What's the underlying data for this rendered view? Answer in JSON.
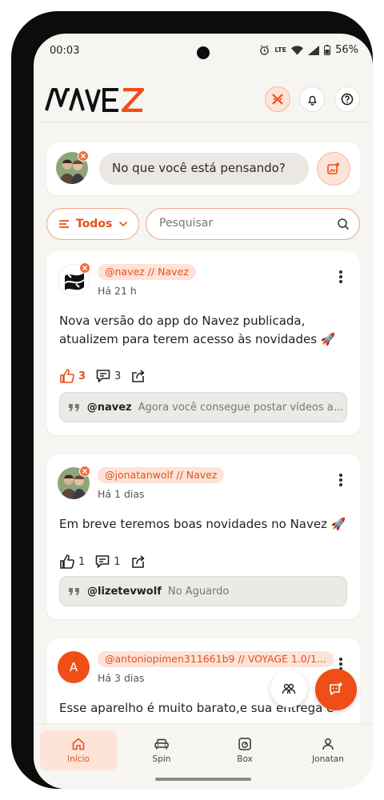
{
  "status_bar": {
    "time": "00:03",
    "battery": "56%",
    "network": "LTE"
  },
  "header": {
    "logo": "NAVEZ"
  },
  "composer": {
    "prompt": "No que você está pensando?"
  },
  "filter": {
    "label": "Todos",
    "search_placeholder": "Pesquisar"
  },
  "posts": [
    {
      "tag": "@navez // Navez",
      "time": "Há 21 h",
      "text": "Nova versão do app do Navez publicada, atualizem para terem acesso às novidades 🚀",
      "likes": "3",
      "comments": "3",
      "liked": true,
      "last_comment": {
        "user": "@navez",
        "text": "Agora você consegue postar vídeos aq..."
      }
    },
    {
      "tag": "@jonatanwolf // Navez",
      "time": "Há 1 dias",
      "text": "Em breve teremos boas novidades no Navez 🚀",
      "likes": "1",
      "comments": "1",
      "liked": false,
      "last_comment": {
        "user": "@lizetevwolf",
        "text": "No Aguardo"
      }
    },
    {
      "avatar_letter": "A",
      "tag": "@antoniopimen311661b9 // VOYAGE 1.0/1...",
      "time": "Há 3 dias",
      "text": "Esse aparelho é muito barato,e sua entrega é"
    }
  ],
  "nav": {
    "items": [
      {
        "label": "Início",
        "icon": "home-icon"
      },
      {
        "label": "Spin",
        "icon": "car-icon"
      },
      {
        "label": "Box",
        "icon": "box-icon"
      },
      {
        "label": "Jonatan",
        "icon": "profile-icon"
      }
    ]
  },
  "colors": {
    "brand": "#e5501a",
    "brand_light": "#fde3d8",
    "background": "#f7f5f2"
  }
}
